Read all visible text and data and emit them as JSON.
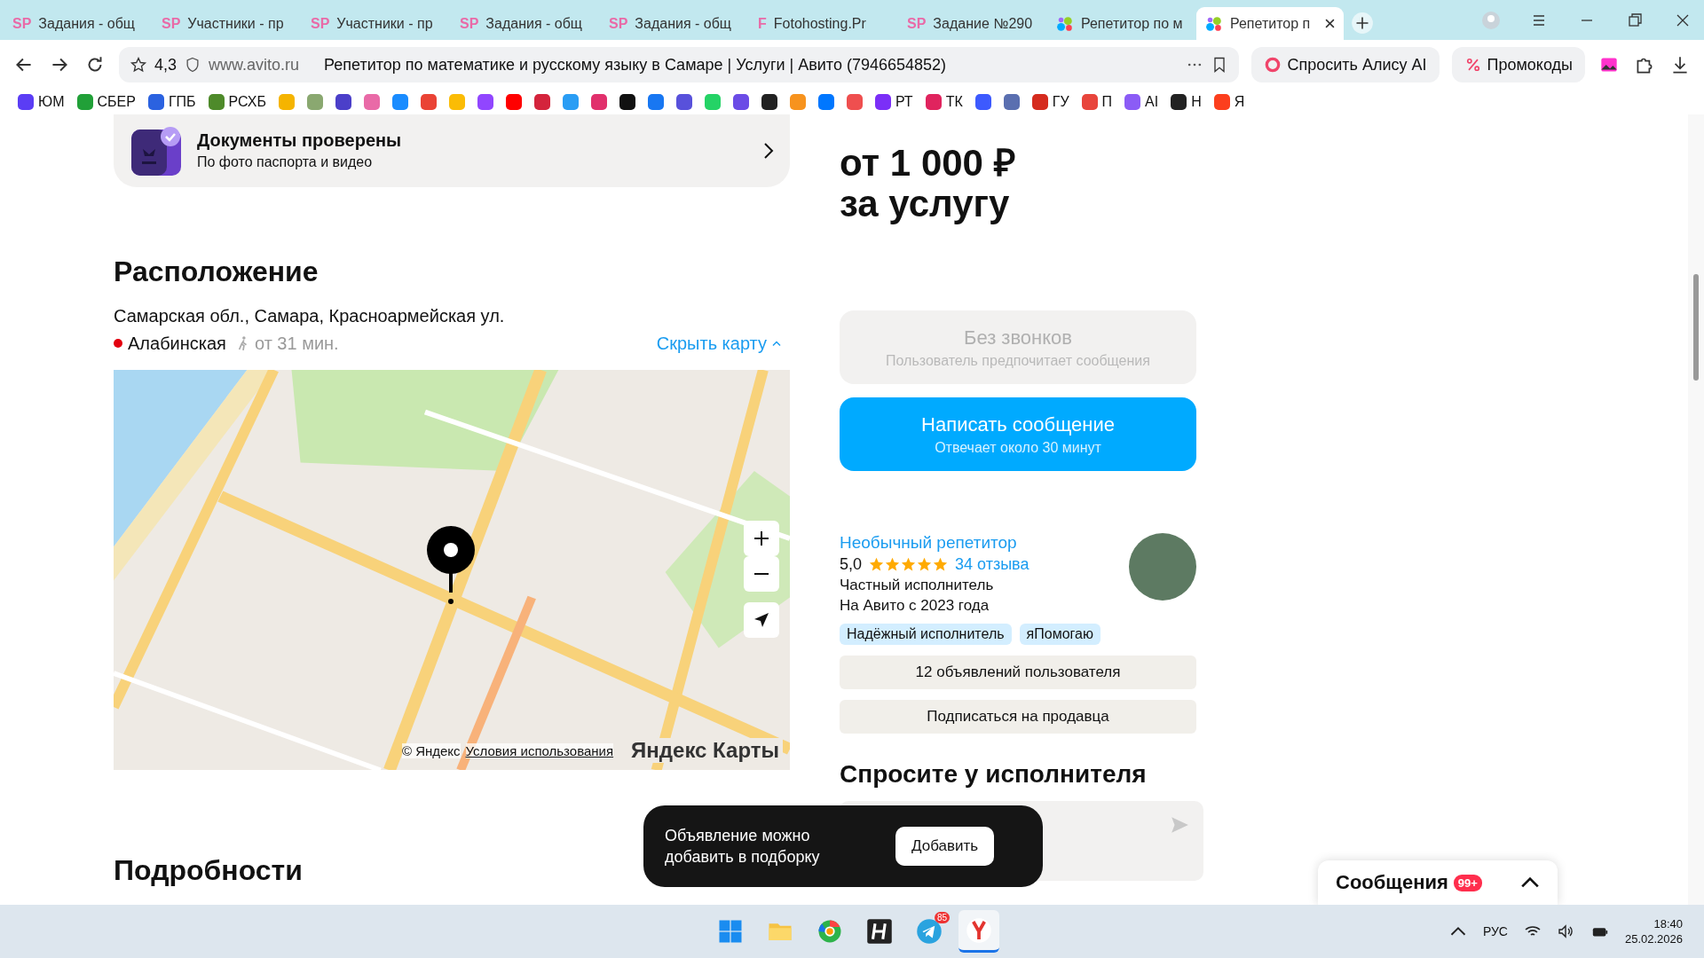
{
  "browser": {
    "tabs": [
      {
        "title": "Задания - общ",
        "icon_text": "SP",
        "selected": false
      },
      {
        "title": "Участники - пр",
        "icon_text": "SP",
        "selected": false
      },
      {
        "title": "Участники - пр",
        "icon_text": "SP",
        "selected": false
      },
      {
        "title": "Задания - общ",
        "icon_text": "SP",
        "selected": false
      },
      {
        "title": "Задания - общ",
        "icon_text": "SP",
        "selected": false
      },
      {
        "title": "Fotohosting.Pr",
        "icon_text": "F",
        "selected": false
      },
      {
        "title": "Задание №290",
        "icon_text": "SP",
        "selected": false
      },
      {
        "title": "Репетитор по м",
        "selected": false
      },
      {
        "title": "Репетитор п",
        "selected": true
      }
    ],
    "rating": "4,3",
    "url": "www.avito.ru",
    "page_title": "Репетитор по математике и русскому языку в Самаре | Услуги | Авито (7946654852)",
    "alice": "Спросить Алису AI",
    "promo": "Промокоды",
    "bookmarks": [
      {
        "label": "ЮМ",
        "color": "#5b3df5"
      },
      {
        "label": "СБЕР",
        "color": "#21a038"
      },
      {
        "label": "ГПБ",
        "color": "#2b62e0"
      },
      {
        "label": "РСХБ",
        "color": "#4e8a2a"
      },
      {
        "color": "#f5b400"
      },
      {
        "color": "#8aa870"
      },
      {
        "color": "#4b3fc9"
      },
      {
        "color": "#e96aa7"
      },
      {
        "color": "#1a8cff"
      },
      {
        "color": "#ea4335"
      },
      {
        "color": "#fbbc05"
      },
      {
        "color": "#9146ff"
      },
      {
        "color": "#ff0000"
      },
      {
        "color": "#d4243c"
      },
      {
        "color": "#2a9df4"
      },
      {
        "color": "#e1306c"
      },
      {
        "color": "#111111"
      },
      {
        "color": "#1877f2"
      },
      {
        "color": "#5851db"
      },
      {
        "color": "#25d366"
      },
      {
        "color": "#6b4ce6"
      },
      {
        "color": "#222222"
      },
      {
        "color": "#f7931e"
      },
      {
        "color": "#0077ff"
      },
      {
        "color": "#ef4f4f"
      },
      {
        "label": "РТ",
        "color": "#7b2ff7"
      },
      {
        "label": "ТК",
        "color": "#e0245e"
      },
      {
        "color": "#3d5afe"
      },
      {
        "color": "#5a6fb0"
      },
      {
        "label": "ГУ",
        "color": "#d52b1e"
      },
      {
        "label": "П",
        "color": "#e8453c"
      },
      {
        "label": "AI",
        "color": "#8b5cf6"
      },
      {
        "label": "Н",
        "color": "#222222"
      },
      {
        "label": "Я",
        "color": "#fc3f1d"
      }
    ]
  },
  "verified": {
    "title": "Документы проверены",
    "subtitle": "По фото паспорта и видео"
  },
  "price": {
    "amount": "от 1 000 ₽",
    "unit": "за услугу"
  },
  "location": {
    "heading": "Расположение",
    "address": "Самарская обл., Самара, Красноармейская ул.",
    "metro": "Алабинская",
    "walk": "от 31 мин.",
    "hide_map": "Скрыть карту"
  },
  "map": {
    "attribution": "© Яндекс",
    "terms": "Условия использования",
    "logo": "Яндекс Карты"
  },
  "contact": {
    "no_calls": {
      "title": "Без звонков",
      "subtitle": "Пользователь предпочитает сообщения",
      "disabled": true
    },
    "write": {
      "title": "Написать сообщение",
      "subtitle": "Отвечает около 30 минут"
    }
  },
  "seller": {
    "name": "Необычный репетитор",
    "rating": "5,0",
    "stars": 5,
    "reviews": "34 отзыва",
    "type": "Частный исполнитель",
    "since": "На Авито с 2023 года",
    "tags": [
      "Надёжный исполнитель",
      "яПомогаю"
    ],
    "buttons": [
      "12 объявлений пользователя",
      "Подписаться на продавца"
    ]
  },
  "ask_heading": "Спросите у исполнителя",
  "details_heading": "Подробности",
  "toast": {
    "text": "Объявление можно добавить в подборку",
    "button": "Добавить"
  },
  "messages": {
    "title": "Сообщения",
    "badge": "99+"
  },
  "taskbar": {
    "apps": [
      {
        "kind": "start",
        "selected": false
      },
      {
        "kind": "folder",
        "selected": false
      },
      {
        "kind": "browser",
        "selected": false
      },
      {
        "kind": "h",
        "selected": false
      },
      {
        "kind": "telegram",
        "badge": "85",
        "selected": false
      },
      {
        "kind": "yandex",
        "selected": true
      }
    ],
    "language": "РУС",
    "time": "18:40",
    "date": "25.02.2026"
  }
}
